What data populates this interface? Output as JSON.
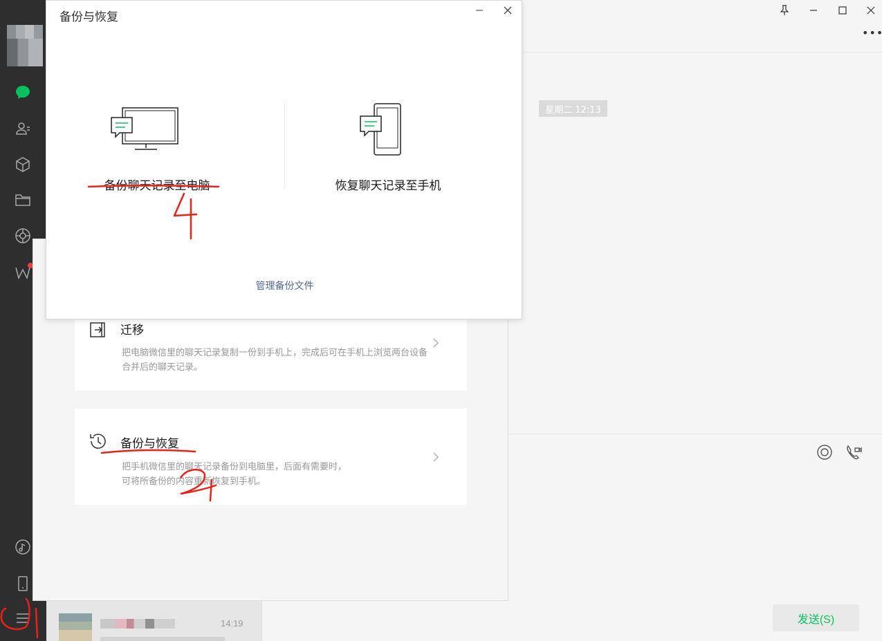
{
  "chat": {
    "time_chip": "星期二 12:13",
    "send_label": "发送(S)"
  },
  "chat_list": {
    "time": "14:19"
  },
  "settings": {
    "migrate": {
      "title": "迁移",
      "desc": "把电脑微信里的聊天记录复制一份到手机上，完成后可在手机上浏览两台设备合并后的聊天记录。"
    },
    "backup": {
      "title": "备份与恢复",
      "desc_line1": "把手机微信里的聊天记录备份到电脑里，后面有需要时，",
      "desc_line2": "可将所备份的内容重新恢复到手机。"
    }
  },
  "dialog": {
    "title": "备份与恢复",
    "backup_to_pc": "备份聊天记录至电脑",
    "restore_to_phone": "恢复聊天记录至手机",
    "manage_link": "管理备份文件"
  },
  "annotations": {
    "step_1": "1",
    "step_2": "2",
    "step_4": "4",
    "color": "#e8221b"
  },
  "colors": {
    "nav_bg": "#2e2e2e",
    "accent_green": "#07c160",
    "link_blue": "#576b95"
  }
}
